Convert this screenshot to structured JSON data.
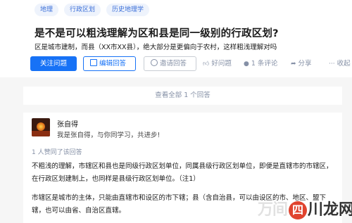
{
  "tags": [
    "地理",
    "行政区划",
    "历史地理学"
  ],
  "question": {
    "title": "是不是可以粗浅理解为区和县是同一级别的行政区划?",
    "detail": "区是城市建制，而县（XX市XX县），绝大部分是更偏向于农村，这样粗浅理解对吗"
  },
  "actions": {
    "follow": "关注问题",
    "edit": "编辑回答",
    "invite": "邀请回答",
    "good_question": "好问题",
    "comments": "1 条评论",
    "share": "分享",
    "collapse": "收起"
  },
  "view_all": "查看全部 1 个回答",
  "answer": {
    "author_name": "张自得",
    "author_bio": "我是张自得，与你同学习，共进步!",
    "upvoted": "1 人赞同了该回答",
    "paragraph1": "不粗浅的理解，市辖区和县也是同级行政区划单位，同属县级行政区划单位，即便是直辖市的市辖区，在行政区划建制上，也同样是县级行政区划单位。（注1）",
    "paragraph2": "市辖区是城市的主体，只能由直辖市和设区的市下辖；县（含自治县，可以由设区的市、地区、盟下辖，也可以由省、自治区直辖。"
  },
  "watermark": {
    "ghost": "万间",
    "circle": "四",
    "main": "川龙网"
  },
  "colors": {
    "primary": "#1772f6",
    "tag_bg": "#eef3fc",
    "muted": "#8590a6",
    "watermark_red": "#e0442f"
  }
}
